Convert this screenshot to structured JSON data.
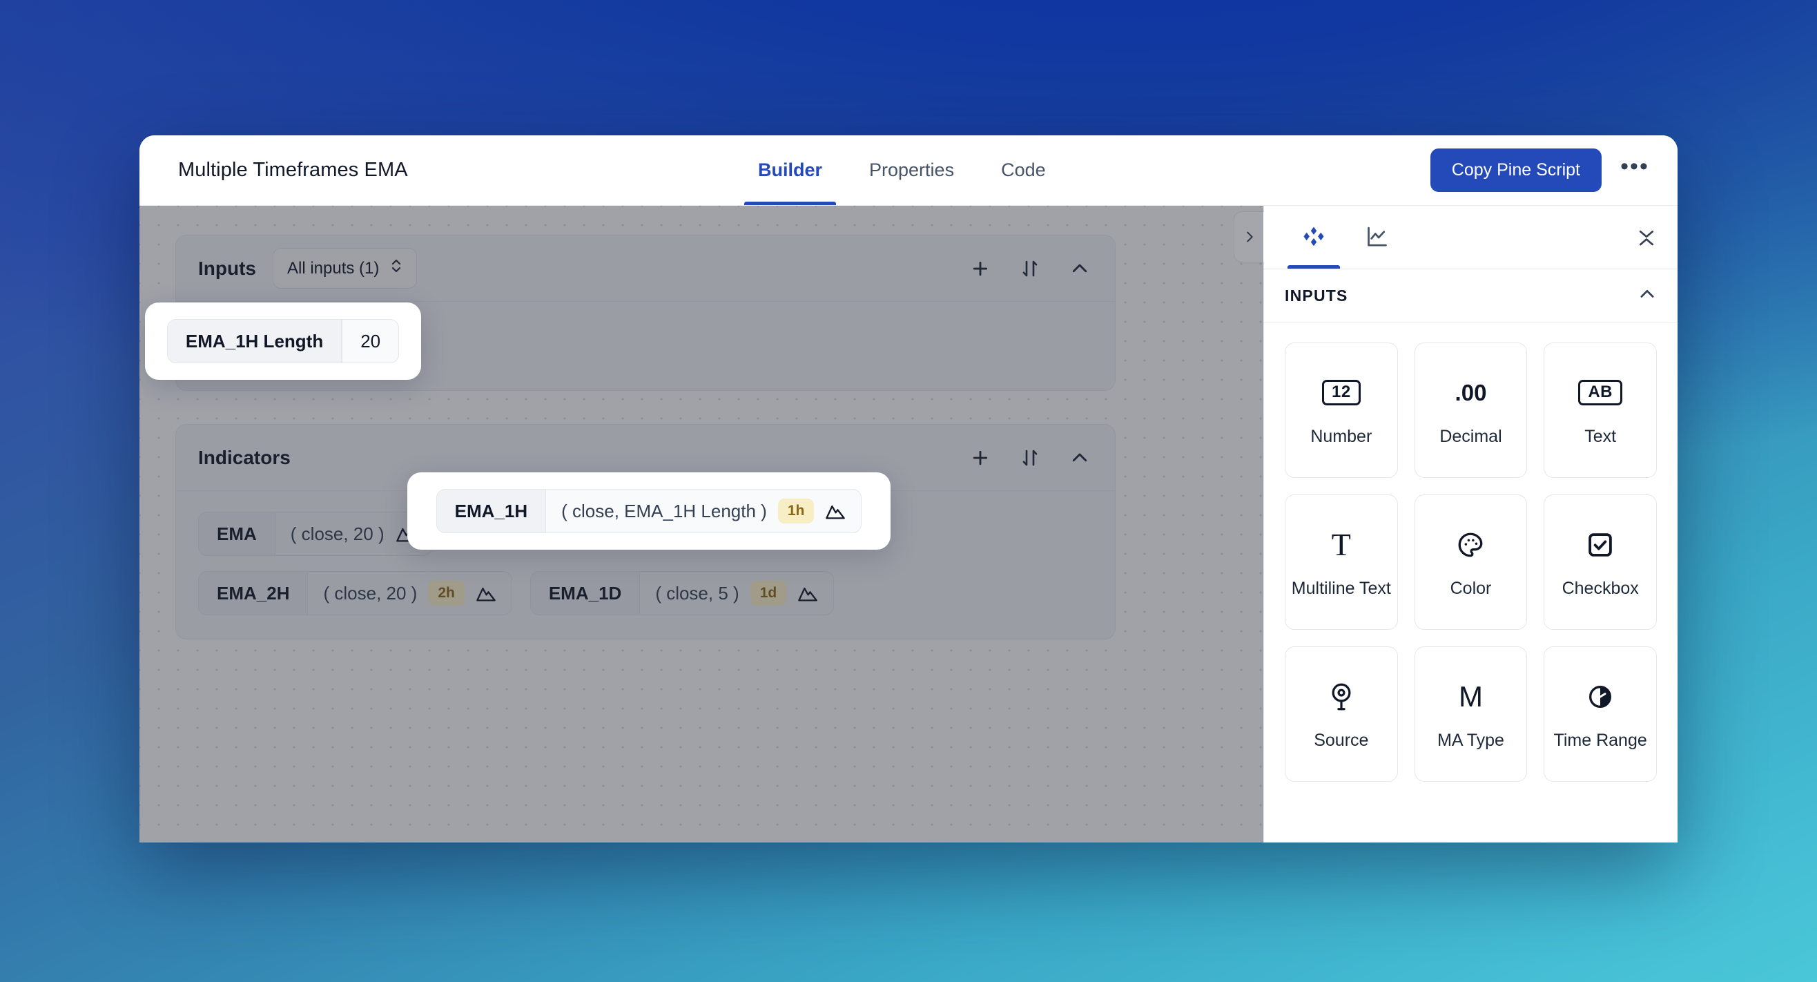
{
  "window": {
    "title": "Multiple Timeframes EMA",
    "tabs": [
      {
        "label": "Builder",
        "active": true
      },
      {
        "label": "Properties",
        "active": false
      },
      {
        "label": "Code",
        "active": false
      }
    ],
    "copy_button": "Copy Pine Script",
    "more_menu": "•••",
    "accent_color": "#2449b8"
  },
  "canvas": {
    "inputs_group": {
      "title": "Inputs",
      "filter_label": "All inputs (1)",
      "actions": [
        "add",
        "sort",
        "collapse"
      ],
      "items": [
        {
          "name": "EMA_1H Length",
          "value": "20",
          "highlighted": true
        }
      ]
    },
    "indicators_group": {
      "title": "Indicators",
      "actions": [
        "add",
        "sort",
        "collapse"
      ],
      "items": [
        {
          "name": "EMA",
          "args": "( close, 20 )",
          "timeframe": "",
          "highlighted": false
        },
        {
          "name": "EMA_1H",
          "args": "( close, EMA_1H Length )",
          "timeframe": "1h",
          "highlighted": true
        },
        {
          "name": "EMA_2H",
          "args": "( close, 20 )",
          "timeframe": "2h",
          "highlighted": false
        },
        {
          "name": "EMA_1D",
          "args": "( close, 5 )",
          "timeframe": "1d",
          "highlighted": false
        }
      ]
    }
  },
  "right_panel": {
    "expand_toggle": "chevron-right",
    "tabs": [
      {
        "icon": "components-diamond-icon",
        "active": true
      },
      {
        "icon": "line-chart-icon",
        "active": false
      }
    ],
    "collapse_all": "collapse-both-icon",
    "section": {
      "title": "INPUTS",
      "collapsed": false,
      "tiles": [
        {
          "label": "Number",
          "icon": "number-12-icon",
          "glyph": "12",
          "glyph_style": "boxed"
        },
        {
          "label": "Decimal",
          "icon": "decimal-icon",
          "glyph": ".00",
          "glyph_style": "plain"
        },
        {
          "label": "Text",
          "icon": "text-ab-icon",
          "glyph": "AB",
          "glyph_style": "boxed"
        },
        {
          "label": "Multiline Text",
          "icon": "multiline-text-icon",
          "glyph": "T",
          "glyph_style": "serif"
        },
        {
          "label": "Color",
          "icon": "palette-icon",
          "glyph": "",
          "glyph_style": "svg"
        },
        {
          "label": "Checkbox",
          "icon": "checkbox-icon",
          "glyph": "",
          "glyph_style": "svg"
        },
        {
          "label": "Source",
          "icon": "source-pin-icon",
          "glyph": "",
          "glyph_style": "svg"
        },
        {
          "label": "MA Type",
          "icon": "ma-type-icon",
          "glyph": "M",
          "glyph_style": "thin"
        },
        {
          "label": "Time Range",
          "icon": "time-range-icon",
          "glyph": "",
          "glyph_style": "svg"
        }
      ]
    }
  }
}
